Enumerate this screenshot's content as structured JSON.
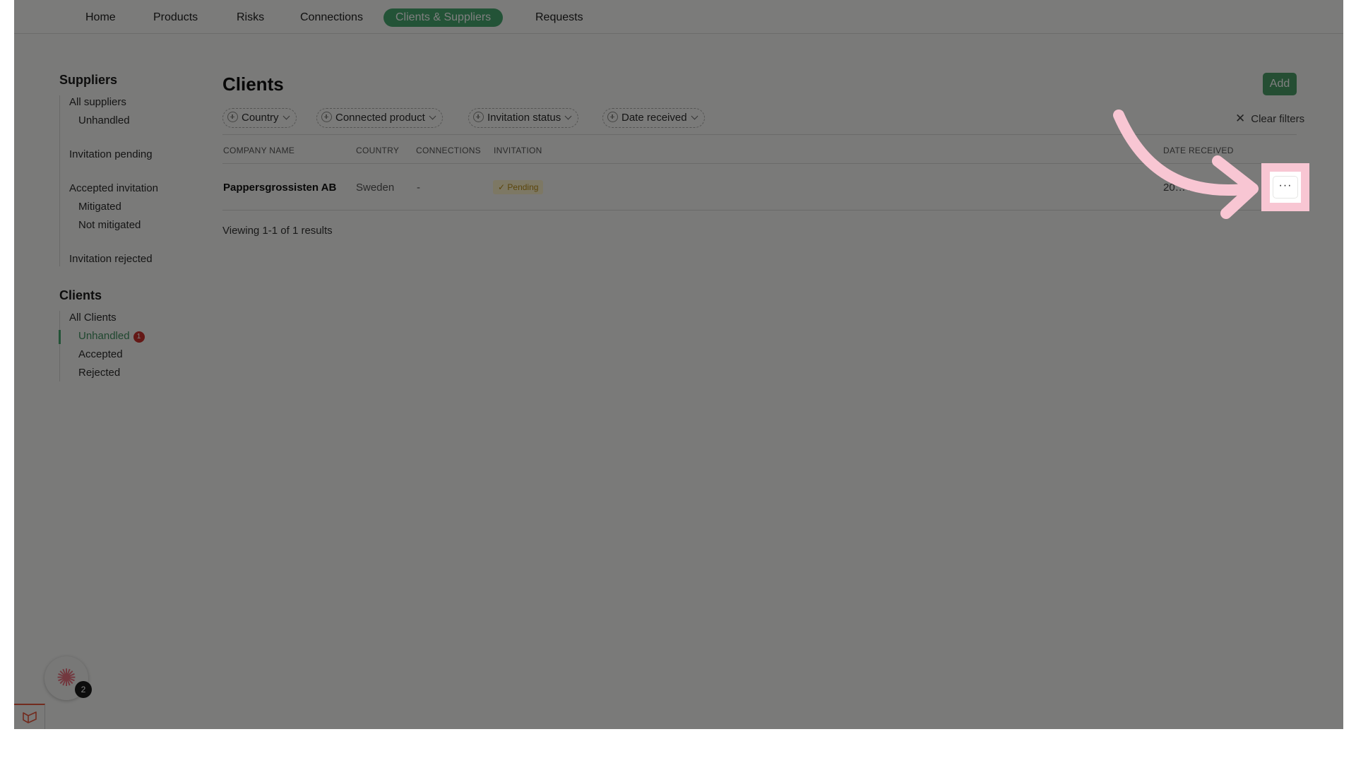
{
  "nav": {
    "items": [
      {
        "label": "Home",
        "active": false
      },
      {
        "label": "Products",
        "active": false
      },
      {
        "label": "Risks",
        "active": false
      },
      {
        "label": "Connections",
        "active": false
      },
      {
        "label": "Clients & Suppliers",
        "active": true
      },
      {
        "label": "Requests",
        "active": false
      }
    ]
  },
  "sidebar": {
    "suppliers": {
      "heading": "Suppliers",
      "items": [
        {
          "label": "All suppliers"
        },
        {
          "label": "Unhandled"
        },
        {
          "label": "Invitation pending"
        },
        {
          "label": "Accepted invitation"
        },
        {
          "label": "Mitigated"
        },
        {
          "label": "Not mitigated"
        },
        {
          "label": "Invitation rejected"
        }
      ]
    },
    "clients": {
      "heading": "Clients",
      "items": [
        {
          "label": "All Clients"
        },
        {
          "label": "Unhandled",
          "badge": "1",
          "active": true
        },
        {
          "label": "Accepted"
        },
        {
          "label": "Rejected"
        }
      ]
    }
  },
  "main": {
    "title": "Clients",
    "add_label": "Add",
    "filters": [
      {
        "label": "Country"
      },
      {
        "label": "Connected product"
      },
      {
        "label": "Invitation status"
      },
      {
        "label": "Date received"
      }
    ],
    "clear_filters": "Clear filters",
    "table": {
      "headers": [
        "COMPANY NAME",
        "COUNTRY",
        "CONNECTIONS",
        "INVITATION",
        "DATE RECEIVED"
      ],
      "rows": [
        {
          "company": "Pappersgrossisten AB",
          "country": "Sweden",
          "connections": "-",
          "invitation": "Pending",
          "date_received": "20…4"
        }
      ]
    },
    "results_text": "Viewing 1-1 of 1 results",
    "row_menu_label": "···"
  },
  "widget": {
    "badge_count": "2"
  },
  "colors": {
    "accent": "#47a66f",
    "pending_bg": "#fbf1c8",
    "pending_text": "#b68b17",
    "badge_red": "#c9312d",
    "highlight_pink": "#f8c6d3"
  },
  "icons": [
    "plus-circle-icon",
    "chevron-down-icon",
    "close-icon",
    "more-horizontal-icon",
    "check-icon",
    "sparkle-icon",
    "framework-logo-icon",
    "arrow-icon"
  ]
}
